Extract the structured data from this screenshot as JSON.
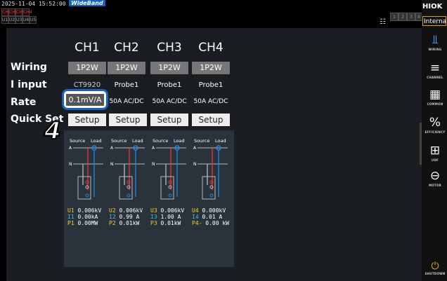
{
  "status": {
    "datetime": "2025-11-04 15:52:00",
    "wideband": "WideBand",
    "ch_boxes_top": [
      "CH1",
      "CH2",
      "CH3",
      "CH4"
    ],
    "ch_boxes_bottom": [
      "U1",
      "U2",
      "U3",
      "U4",
      "U5"
    ],
    "slots": [
      "1",
      "2",
      "3",
      "4"
    ]
  },
  "channels": [
    "CH1",
    "CH2",
    "CH3",
    "CH4"
  ],
  "row_labels": {
    "wiring": "Wiring",
    "input": "I input",
    "rate": "Rate",
    "quickset": "Quick Set"
  },
  "wiring": [
    "1P2W",
    "1P2W",
    "1P2W",
    "1P2W"
  ],
  "i_input": [
    "CT9920",
    "Probe1",
    "Probe1",
    "Probe1"
  ],
  "rate": [
    "0.1mV/A",
    "50A AC/DC",
    "50A AC/DC",
    "50A AC/DC"
  ],
  "setup_label": "Setup",
  "step_number": "4",
  "diagram": {
    "source": "Source",
    "load": "Load",
    "phase_a": "A",
    "neutral": "N",
    "readings": [
      {
        "u": "U1",
        "u_val": "0.006kV",
        "i": "I1",
        "i_val": "0.00kA",
        "p": "P1",
        "p_val": "0.00MW"
      },
      {
        "u": "U2",
        "u_val": "0.006kV",
        "i": "I2",
        "i_val": "0.99 A",
        "p": "P2",
        "p_val": "0.01kW"
      },
      {
        "u": "U3",
        "u_val": "0.006kV",
        "i": "I3",
        "i_val": "1.00 A",
        "p": "P3",
        "p_val": "0.01kW"
      },
      {
        "u": "U4",
        "u_val": "0.000kV",
        "i": "I4",
        "i_val": "0.01 A",
        "p": "P4-",
        "p_val": "0.00 kW"
      }
    ]
  },
  "sidebar": {
    "brand": "HIOK",
    "mode": "Interna",
    "items": [
      {
        "label": "WIRING",
        "icon": "wiring-icon"
      },
      {
        "label": "CHANNEL",
        "icon": "channel-icon"
      },
      {
        "label": "COMMON",
        "icon": "common-icon"
      },
      {
        "label": "EFFICIENCY",
        "icon": "efficiency-icon"
      },
      {
        "label": "UDF",
        "icon": "udf-icon"
      },
      {
        "label": "MOTOR",
        "icon": "motor-icon"
      },
      {
        "label": "SHUTDOWN",
        "icon": "shutdown-icon"
      }
    ]
  },
  "colors": {
    "accent": "#1565c0",
    "voltage": "#f5d21b",
    "current": "#36c0f0",
    "shutdown": "#f0b000"
  }
}
